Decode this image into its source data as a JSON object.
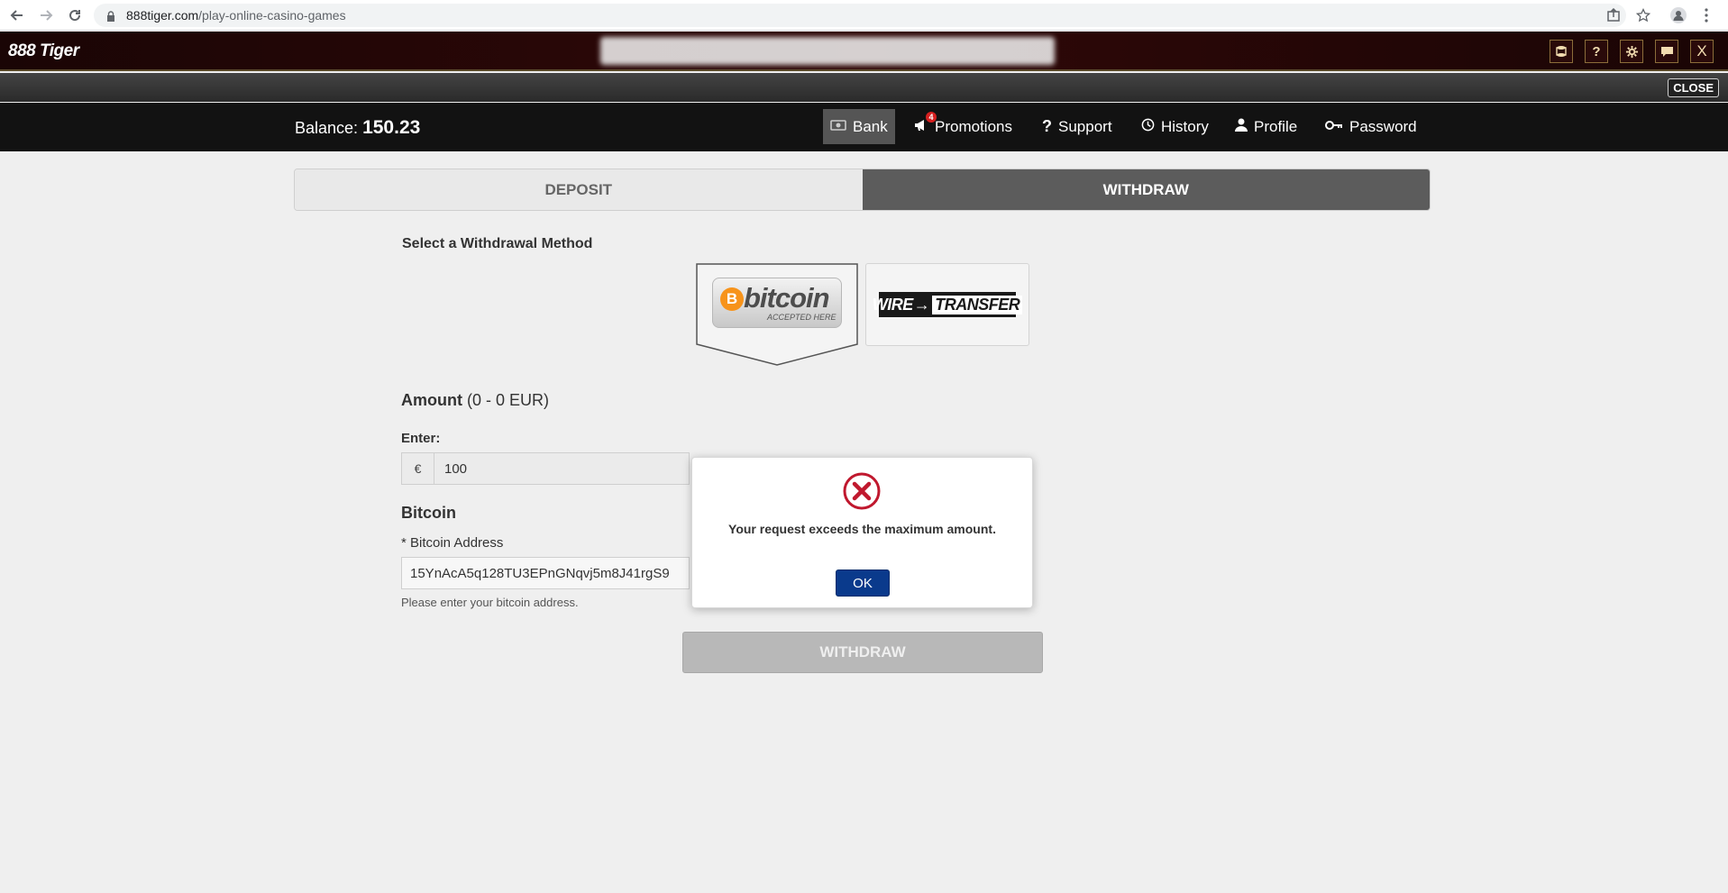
{
  "browser": {
    "url_host": "888tiger.com",
    "url_path": "/play-online-casino-games"
  },
  "site": {
    "logo": "888 Tiger",
    "header_icons": [
      "cashier-icon",
      "help-icon",
      "settings-icon",
      "chat-icon",
      "close-icon"
    ],
    "close_label": "CLOSE"
  },
  "cashier": {
    "balance_label": "Balance:",
    "balance_value": "150.23",
    "nav": [
      {
        "label": "Bank",
        "icon": "bank-icon",
        "active": true
      },
      {
        "label": "Promotions",
        "icon": "megaphone-icon",
        "badge": "4"
      },
      {
        "label": "Support",
        "icon": "question-icon"
      },
      {
        "label": "History",
        "icon": "history-icon"
      },
      {
        "label": "Profile",
        "icon": "user-icon"
      },
      {
        "label": "Password",
        "icon": "key-icon"
      }
    ],
    "tabs": {
      "deposit": "DEPOSIT",
      "withdraw": "WITHDRAW"
    },
    "select_method_label": "Select a Withdrawal Method",
    "methods": {
      "bitcoin": {
        "word": "bitcoin",
        "sub": "ACCEPTED HERE",
        "coin": "B"
      },
      "wire": {
        "left": "WIRE",
        "right": "TRANSFER"
      }
    },
    "amount": {
      "title": "Amount",
      "range": " (0 - 0 EUR)",
      "enter_label": "Enter:",
      "currency": "€",
      "value": "100"
    },
    "bitcoin_section": {
      "heading": "Bitcoin",
      "address_label": "* Bitcoin Address",
      "address_value": "15YnAcA5q128TU3EPnGNqvj5m8J41rgS9",
      "help": "Please enter your bitcoin address."
    },
    "withdraw_button": "WITHDRAW"
  },
  "modal": {
    "message": "Your request exceeds the maximum amount.",
    "ok": "OK",
    "icon_color": "#c0182e"
  }
}
